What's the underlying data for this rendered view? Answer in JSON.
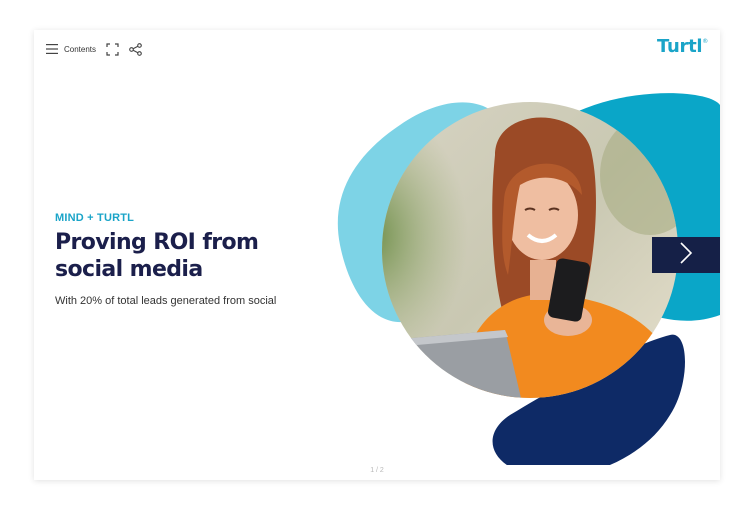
{
  "toolbar": {
    "contents_label": "Contents",
    "icons": [
      "menu-icon",
      "fullscreen-icon",
      "share-icon"
    ]
  },
  "logo": {
    "text": "Turtl",
    "mark": "®",
    "color": "#1aa4c8"
  },
  "slide": {
    "eyebrow": "MIND + TURTL",
    "title_line1": "Proving ROI from",
    "title_line2": "social media",
    "subtitle": "With 20% of total leads generated from social"
  },
  "pagination": {
    "label": "1 / 2"
  },
  "nav": {
    "next_icon": "chevron-right-icon"
  },
  "colors": {
    "accent": "#1aa4c8",
    "title": "#1b1f4b",
    "navy": "#0e2a66",
    "light_blue": "#7dd3e6",
    "teal": "#0aa6c8",
    "next_button": "#152047",
    "text": "#333333"
  }
}
